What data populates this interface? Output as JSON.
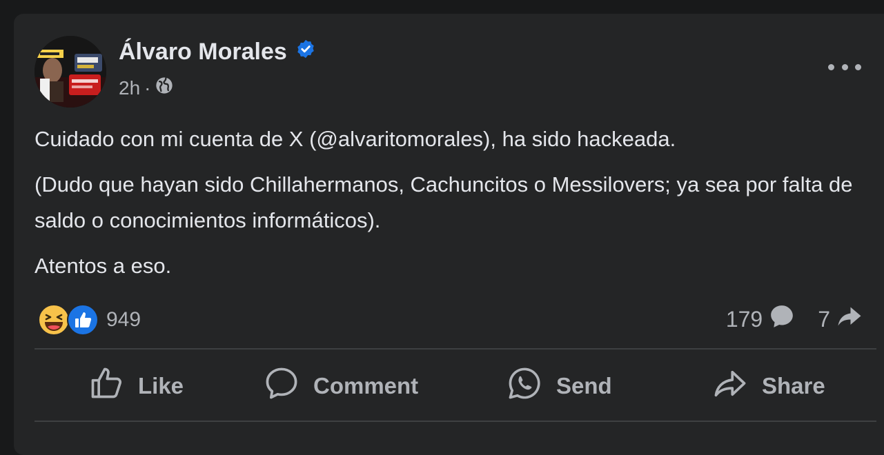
{
  "post": {
    "author": "Álvaro Morales",
    "time": "2h",
    "visibility_separator": "·",
    "paragraphs": [
      "Cuidado con mi cuenta de X (@alvaritomorales), ha sido hackeada.",
      "(Dudo que hayan sido Chillahermanos, Cachuncitos o Messilovers; ya sea por falta de saldo o conocimientos informáticos).",
      "Atentos a eso."
    ],
    "reaction_count": "949",
    "comment_count": "179",
    "share_count": "7"
  },
  "actions": {
    "like": "Like",
    "comment": "Comment",
    "send": "Send",
    "share": "Share"
  },
  "icons": {
    "verified": "verified-badge-icon",
    "globe": "globe-icon",
    "more": "more-options-icon",
    "haha": "haha-reaction-icon",
    "like_reaction": "like-reaction-icon",
    "comment_bubble": "comment-bubble-icon",
    "share_arrow": "share-arrow-icon"
  },
  "colors": {
    "background": "#18191a",
    "card": "#242526",
    "text_primary": "#e4e6eb",
    "text_secondary": "#b0b3b8",
    "verified_blue": "#1b74e4",
    "divider": "#3e4042"
  }
}
